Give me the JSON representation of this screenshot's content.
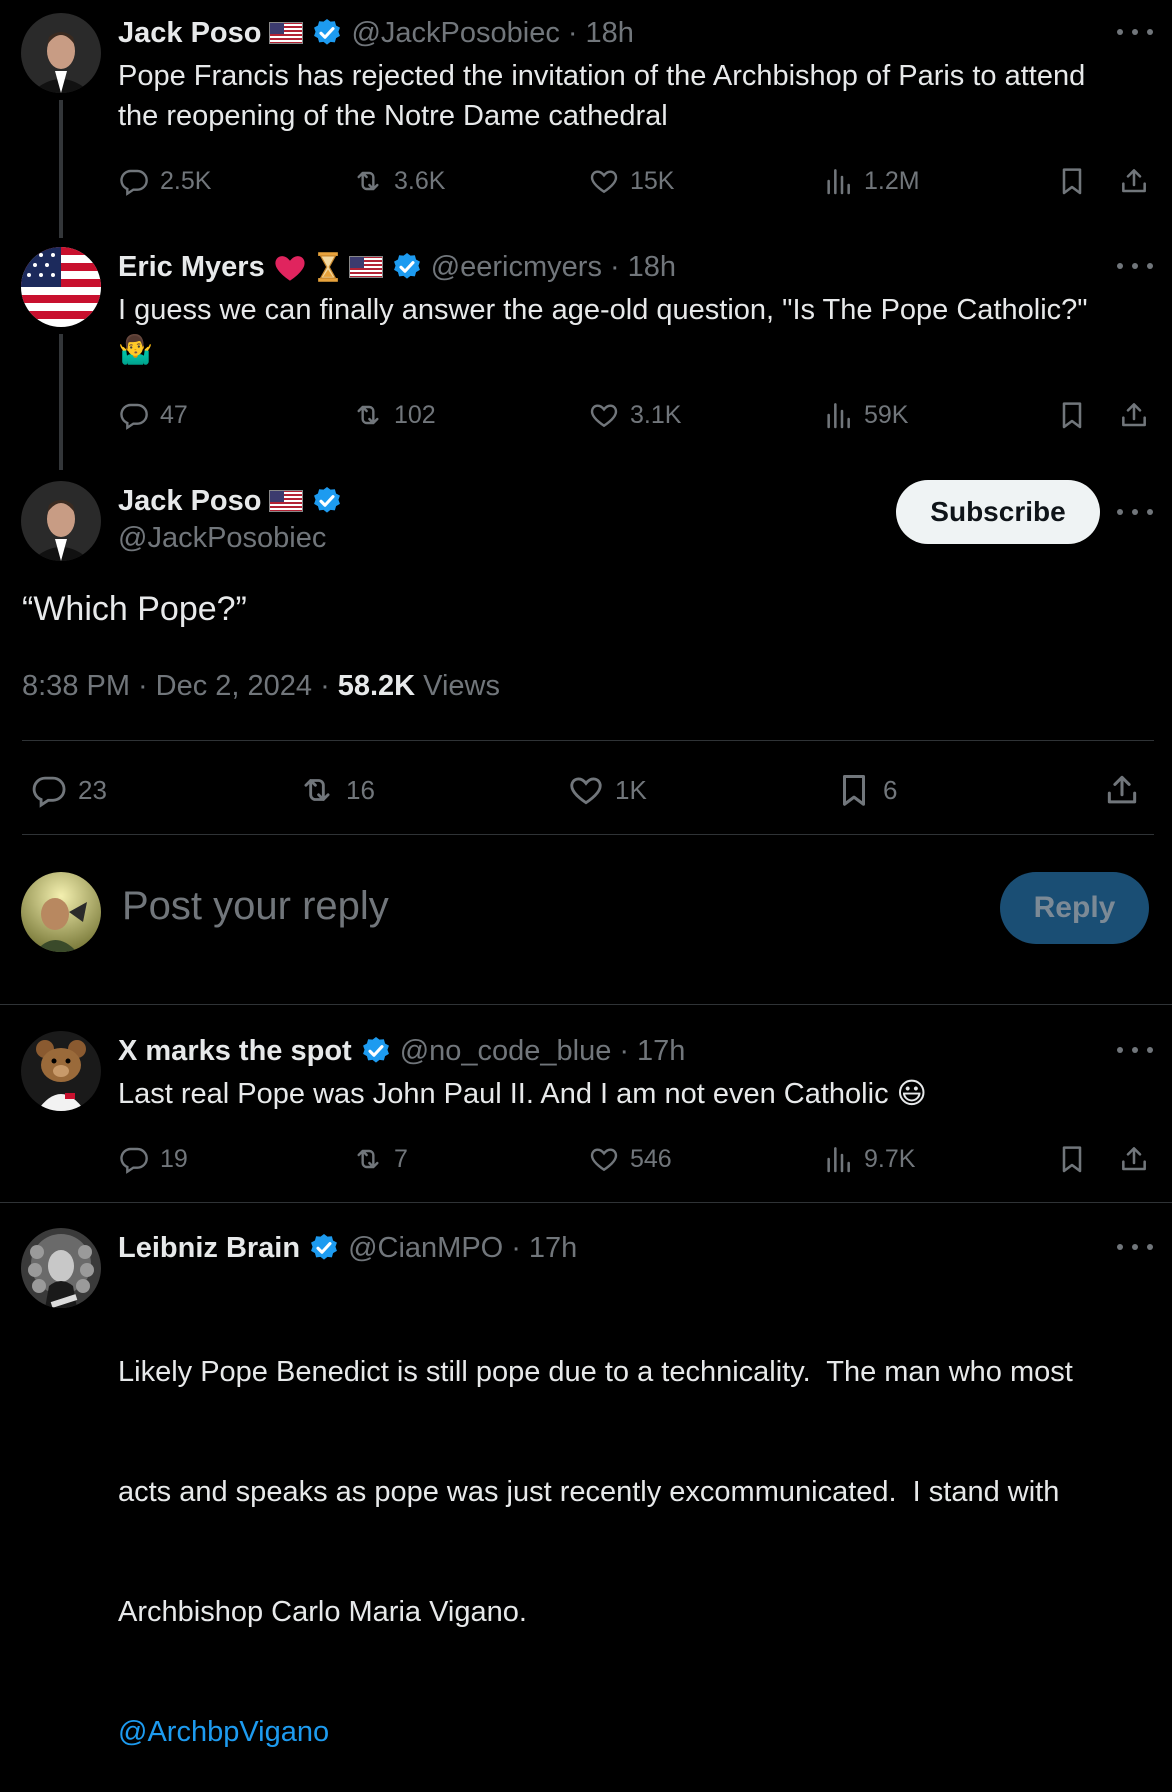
{
  "thread": {
    "post1": {
      "name": "Jack Poso",
      "handle": "@JackPosobiec",
      "time": "18h",
      "text_line1": "Pope Francis has rejected the invitation of the Archbishop of Paris to attend",
      "text_line2": "the reopening of the Notre Dame cathedral",
      "replies": "2.5K",
      "reposts": "3.6K",
      "likes": "15K",
      "views": "1.2M"
    },
    "post2": {
      "name": "Eric Myers",
      "handle": "@eericmyers",
      "time": "18h",
      "text": "I guess we can finally answer the age-old question, \"Is The Pope Catholic?\"",
      "emoji": "🤷‍♂️",
      "replies": "47",
      "reposts": "102",
      "likes": "3.1K",
      "views": "59K"
    }
  },
  "main_post": {
    "name": "Jack Poso",
    "handle": "@JackPosobiec",
    "subscribe_label": "Subscribe",
    "text": "“Which Pope?”",
    "time": "8:38 PM",
    "date": "Dec 2, 2024",
    "views_count": "58.2K",
    "views_label": "Views",
    "replies": "23",
    "reposts": "16",
    "likes": "1K",
    "bookmarks": "6"
  },
  "composer": {
    "placeholder": "Post your reply",
    "reply_label": "Reply"
  },
  "replies": [
    {
      "name": "X marks the spot",
      "handle": "@no_code_blue",
      "time": "17h",
      "text": "Last real Pope was John Paul II. And I am not even Catholic",
      "emoji": "😃",
      "replies": "19",
      "reposts": "7",
      "likes": "546",
      "views": "9.7K"
    },
    {
      "name": "Leibniz Brain",
      "handle": "@CianMPO",
      "time": "17h",
      "line1": "Likely Pope Benedict is still pope due to a technicality.  The man who most",
      "line2": "acts and speaks as pope was just recently excommunicated.  I stand with",
      "line3": "Archbishop Carlo Maria Vigano.",
      "mention": "@ArchbpVigano"
    }
  ],
  "separator": "·",
  "colors": {
    "background": "#000000",
    "text": "#e7e9ea",
    "secondary": "#71767b",
    "accent": "#1d9bf0",
    "verified": "#1d9bf0",
    "reply_button": "#1a4e74"
  }
}
